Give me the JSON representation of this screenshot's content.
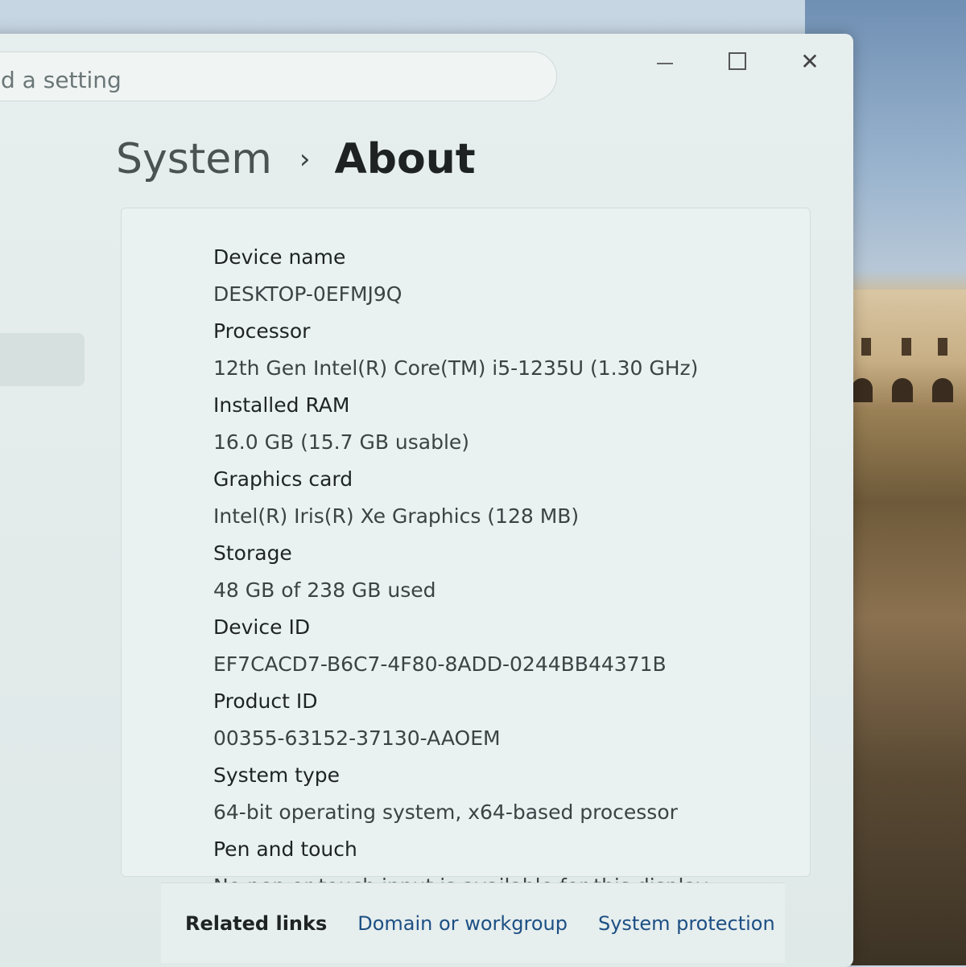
{
  "search": {
    "placeholder": "d a setting"
  },
  "window_controls": {
    "minimize_glyph": "",
    "maximize_glyph": "",
    "close_glyph": "✕"
  },
  "breadcrumb": {
    "parent": "System",
    "separator": "›",
    "current": "About"
  },
  "specs": [
    {
      "label": "Device name",
      "value": "DESKTOP-0EFMJ9Q"
    },
    {
      "label": "Processor",
      "value": "12th Gen Intel(R) Core(TM) i5-1235U (1.30 GHz)"
    },
    {
      "label": "Installed RAM",
      "value": "16.0 GB (15.7 GB usable)"
    },
    {
      "label": "Graphics card",
      "value": "Intel(R) Iris(R) Xe Graphics (128 MB)"
    },
    {
      "label": "Storage",
      "value": "48 GB of 238 GB used"
    },
    {
      "label": "Device ID",
      "value": "EF7CACD7-B6C7-4F80-8ADD-0244BB44371B"
    },
    {
      "label": "Product ID",
      "value": "00355-63152-37130-AAOEM"
    },
    {
      "label": "System type",
      "value": "64-bit operating system, x64-based processor"
    },
    {
      "label": "Pen and touch",
      "value": "No pen or touch input is available for this display"
    }
  ],
  "related": {
    "label": "Related links",
    "links": [
      "Domain or workgroup",
      "System protection"
    ]
  },
  "icons": [
    "minimize-icon",
    "maximize-icon",
    "close-icon",
    "chevron-right-icon"
  ]
}
